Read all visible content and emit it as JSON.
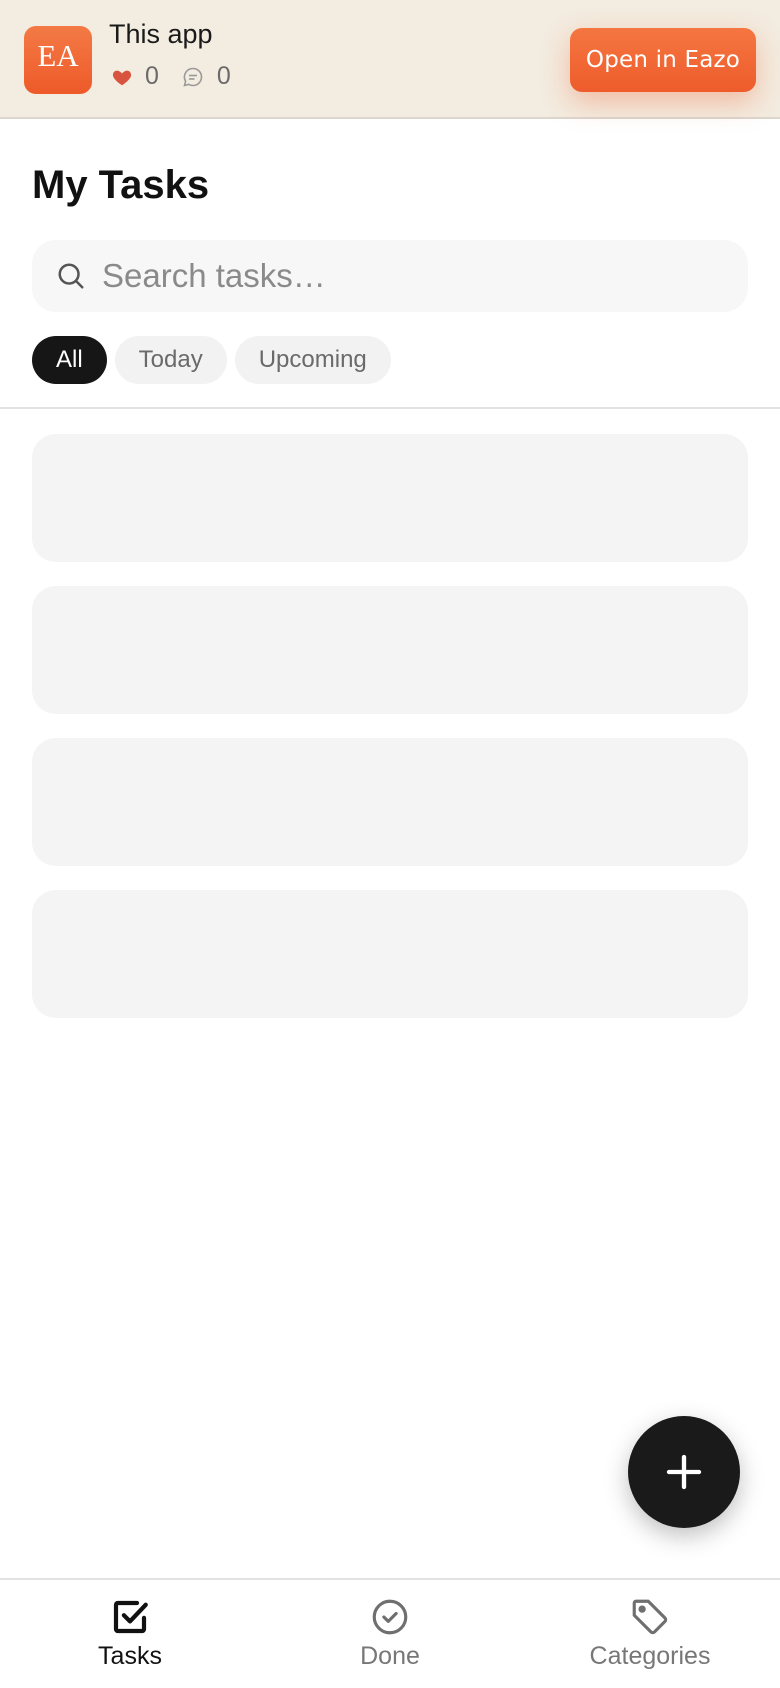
{
  "banner": {
    "logo_text": "EA",
    "app_name": "This app",
    "likes": "0",
    "comments": "0",
    "open_button": "Open in Eazo"
  },
  "header": {
    "title": "My Tasks"
  },
  "search": {
    "placeholder": "Search tasks…",
    "icon": "search-icon"
  },
  "filters": [
    {
      "label": "All",
      "active": true
    },
    {
      "label": "Today",
      "active": false
    },
    {
      "label": "Upcoming",
      "active": false
    }
  ],
  "task_list": {
    "loading_placeholders": 4
  },
  "fab": {
    "icon": "plus-icon"
  },
  "bottom_nav": [
    {
      "label": "Tasks",
      "icon": "checkbox-icon",
      "active": true
    },
    {
      "label": "Done",
      "icon": "check-circle-icon",
      "active": false
    },
    {
      "label": "Categories",
      "icon": "tag-icon",
      "active": false
    }
  ],
  "colors": {
    "brand_orange": "#ee5c2c",
    "banner_bg": "#f3ece0",
    "active_chip": "#161616",
    "skeleton": "#f4f4f4"
  }
}
